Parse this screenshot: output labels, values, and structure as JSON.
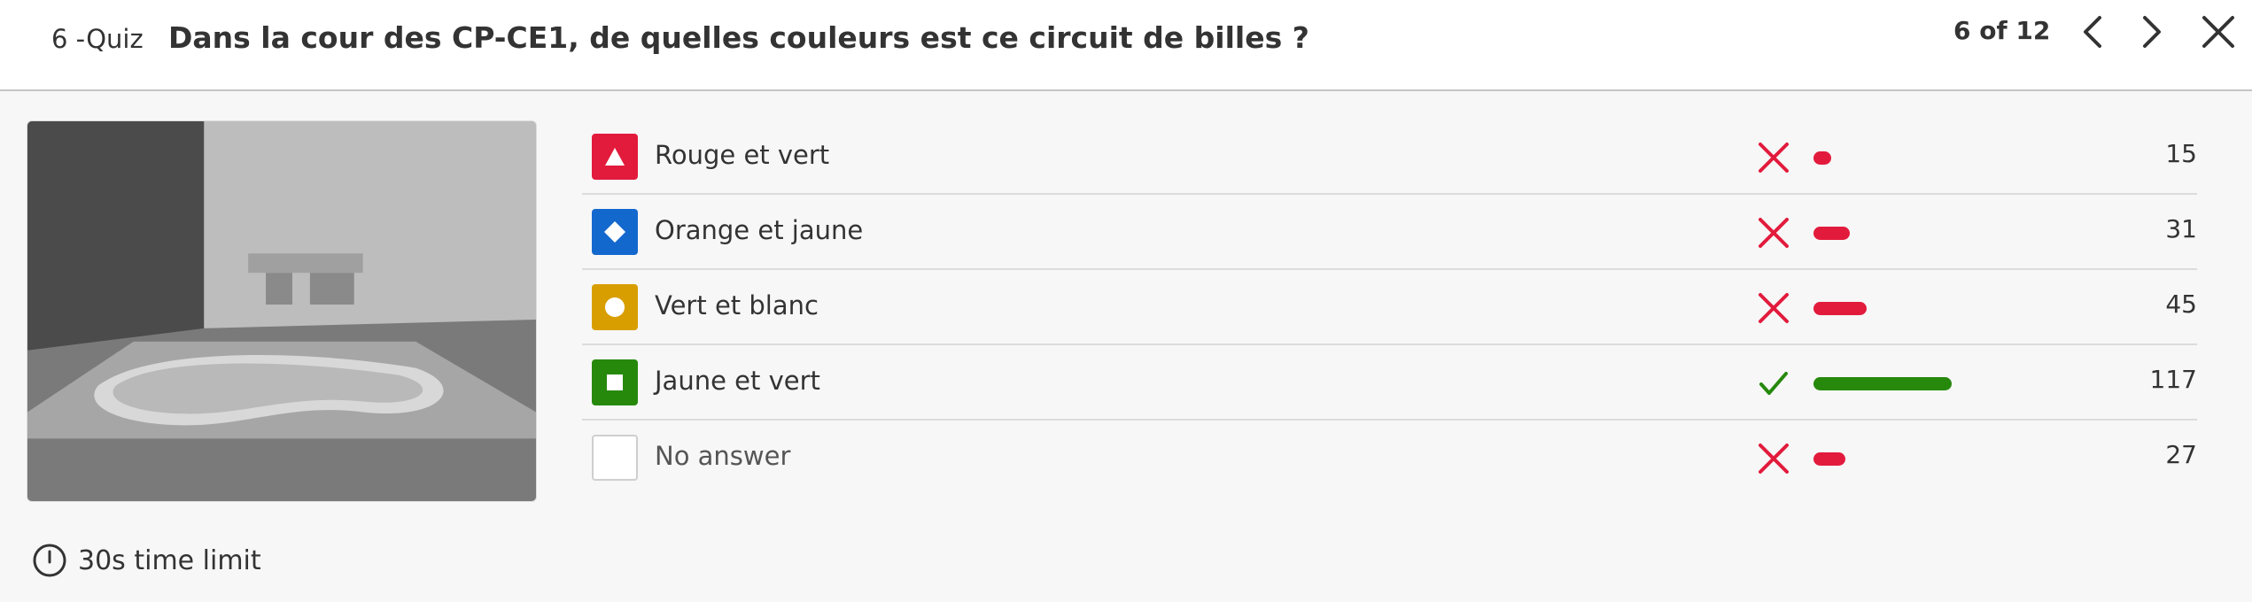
{
  "header": {
    "question_index": "6 -Quiz",
    "question_title": "Dans la cour des CP-CE1, de quelles couleurs est ce circuit de billes ?",
    "counter": "6 of 12"
  },
  "colors": {
    "red": "#e21b3c",
    "blue": "#1368ce",
    "yellow": "#d89e00",
    "green": "#26890c",
    "incorrect": "#e21b3c",
    "correct": "#26890c"
  },
  "answers": [
    {
      "label": "Rouge et vert",
      "shape": "triangle-icon",
      "correct": false,
      "count": "15",
      "share": 0.077
    },
    {
      "label": "Orange et jaune",
      "shape": "diamond-icon",
      "correct": false,
      "count": "31",
      "share": 0.159
    },
    {
      "label": "Vert et blanc",
      "shape": "circle-icon",
      "correct": false,
      "count": "45",
      "share": 0.231
    },
    {
      "label": "Jaune et vert",
      "shape": "square-icon",
      "correct": true,
      "count": "117",
      "share": 0.6
    },
    {
      "label": "No answer",
      "shape": "empty-box",
      "correct": false,
      "count": "27",
      "share": 0.138
    }
  ],
  "footer": {
    "time_limit": "30s time limit"
  }
}
